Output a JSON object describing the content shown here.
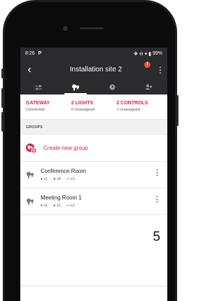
{
  "status": {
    "time": "8:26",
    "battery": "99%"
  },
  "appbar": {
    "title": "Installation site 2",
    "badge": "!"
  },
  "summary": [
    {
      "head": "GATEWAY",
      "sub": "Connected"
    },
    {
      "head": "2 LIGHTS",
      "sub": "0 Unassigned"
    },
    {
      "head": "2 CONTROLS",
      "sub": "1 Unassigned"
    }
  ],
  "groups": {
    "header": "GROUPS",
    "create_label": "Create new group"
  },
  "rows": [
    {
      "name": "Conference Room",
      "c1": "x1",
      "c2": "x0",
      "c3": "x1"
    },
    {
      "name": "Meeting Room 1",
      "c1": "x1",
      "c2": "x1",
      "c3": "x1"
    }
  ],
  "page_number": "5",
  "colors": {
    "accent": "#d7234d",
    "bar": "#2b2b2d"
  },
  "icons": [
    "back-arrow-icon",
    "overflow-menu-icon",
    "sliders-icon",
    "bulb-icon",
    "clock-icon",
    "people-icon",
    "group-bulb-icon",
    "add-icon",
    "sensor-icon",
    "switch-icon"
  ]
}
